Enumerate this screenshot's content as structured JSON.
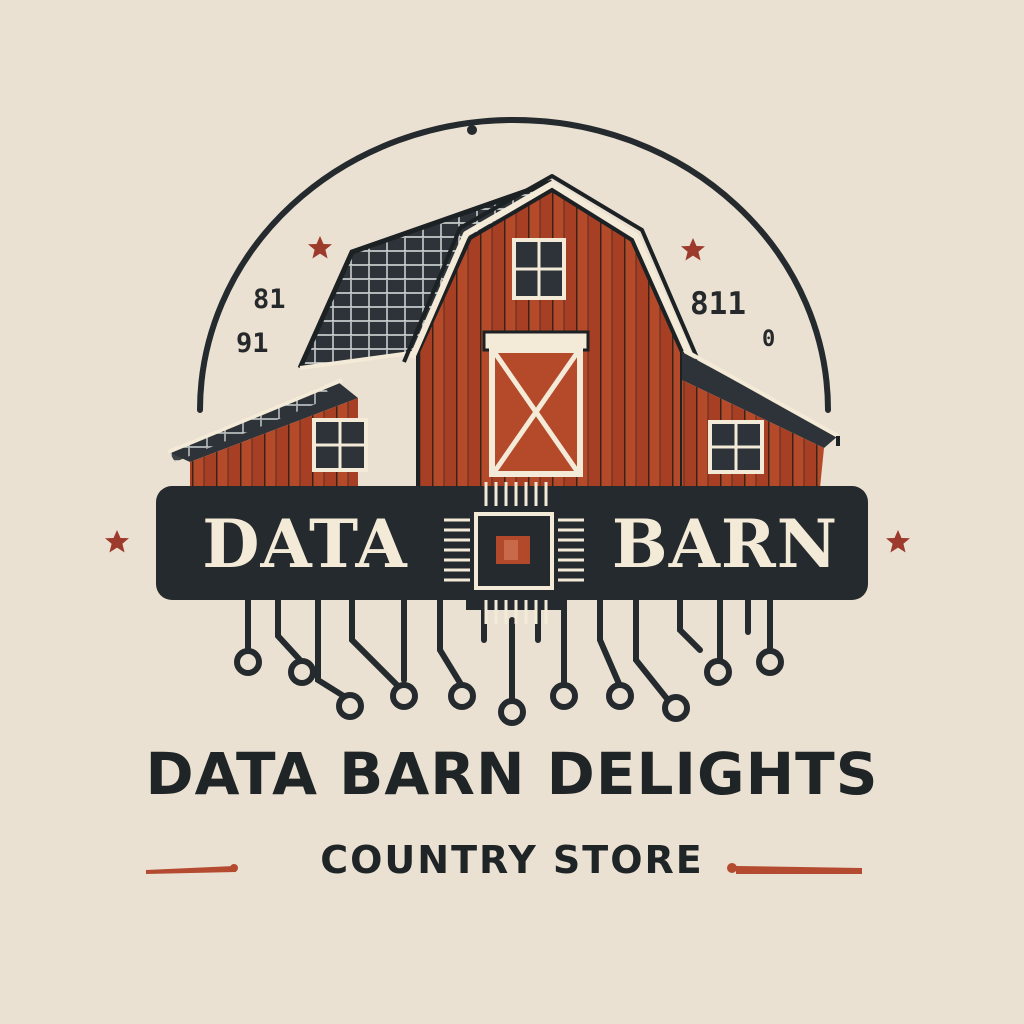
{
  "logo": {
    "brand_left": "DATA",
    "brand_right": "BARN",
    "store_name": "DATA BARN DELIGHTS",
    "tagline": "COUNTRY STORE",
    "numerals": {
      "left_top": "81",
      "left_bottom": "91",
      "right_top": "811",
      "right_bottom": "0"
    }
  },
  "colors": {
    "background": "#ebe1d2",
    "barn_red": "#b2492b",
    "dark": "#242a2d",
    "cream": "#f4ead8",
    "accent_rule": "#b44a30",
    "star": "#9c3a2c"
  },
  "icons": [
    "barn-icon",
    "microchip-icon",
    "star-icon",
    "circuit-trace-icon"
  ]
}
